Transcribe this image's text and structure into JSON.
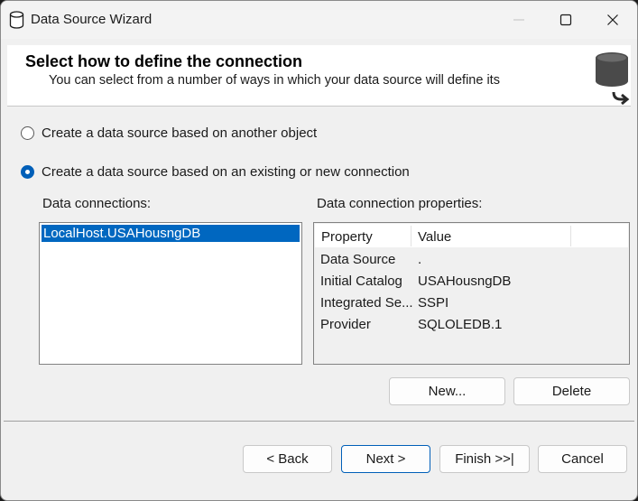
{
  "window": {
    "title": "Data Source Wizard",
    "icon": "database-icon",
    "controls": [
      "minimize-icon",
      "maximize-icon",
      "close-icon"
    ]
  },
  "header": {
    "title": "Select how to define the connection",
    "subtitle": "You can select from a number of ways in which your data source will define its",
    "icon": "database-arrow-icon"
  },
  "options": {
    "another_object": {
      "label": "Create a data source based on another object",
      "selected": false
    },
    "connection": {
      "label": "Create a data source based on an existing or new connection",
      "selected": true
    }
  },
  "connections": {
    "label": "Data connections:",
    "items": [
      "LocalHost.USAHousngDB"
    ],
    "selected_index": 0
  },
  "properties": {
    "label": "Data connection properties:",
    "columns": [
      "Property",
      "Value"
    ],
    "rows": [
      {
        "property": "Data Source",
        "value": "."
      },
      {
        "property": "Initial Catalog",
        "value": "USAHousngDB"
      },
      {
        "property": "Integrated Se...",
        "value": "SSPI"
      },
      {
        "property": "Provider",
        "value": "SQLOLEDB.1"
      }
    ]
  },
  "buttons": {
    "new": "New...",
    "delete": "Delete",
    "back": "< Back",
    "next": "Next >",
    "finish": "Finish >>|",
    "cancel": "Cancel"
  },
  "colors": {
    "accent": "#005fb8",
    "selection": "#0067c0",
    "dialog_bg": "#f0f0f0",
    "header_bg": "#ffffff"
  }
}
